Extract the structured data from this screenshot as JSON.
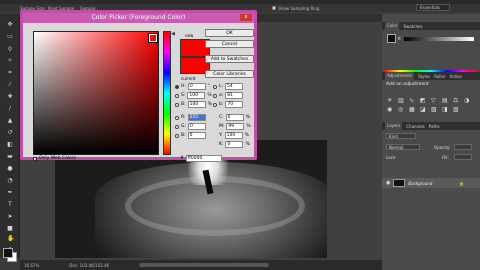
{
  "options_bar": {
    "sample_size_label": "Sample Size:",
    "sample_size_value": "Point Sample",
    "sample_label": "Sample:",
    "show_ring_label": "Show Sampling Ring"
  },
  "workspace_button": "Essentials",
  "dialog": {
    "title": "Color Picker (Foreground Color)",
    "close_label": "x",
    "new_label": "new",
    "current_label": "current",
    "buttons": {
      "ok": "OK",
      "cancel": "Cancel",
      "add_swatches": "Add to Swatches",
      "color_libraries": "Color Libraries"
    },
    "hsb": [
      {
        "label": "H:",
        "value": "0",
        "unit": "°"
      },
      {
        "label": "S:",
        "value": "100",
        "unit": "%"
      },
      {
        "label": "B:",
        "value": "100",
        "unit": "%"
      }
    ],
    "rgb": [
      {
        "label": "R:",
        "value": "255"
      },
      {
        "label": "G:",
        "value": "0"
      },
      {
        "label": "B:",
        "value": "0"
      }
    ],
    "lab": [
      {
        "label": "L:",
        "value": "54"
      },
      {
        "label": "a:",
        "value": "81"
      },
      {
        "label": "b:",
        "value": "70"
      }
    ],
    "cmyk": [
      {
        "label": "C:",
        "value": "0",
        "unit": "%"
      },
      {
        "label": "M:",
        "value": "99",
        "unit": "%"
      },
      {
        "label": "Y:",
        "value": "100",
        "unit": "%"
      },
      {
        "label": "K:",
        "value": "0",
        "unit": "%"
      }
    ],
    "only_web_colors": "Only Web Colors",
    "hex_label": "#",
    "hex_value": "ff0000",
    "selected_color": "#ff0000"
  },
  "right_panel": {
    "color_tabs": [
      "Color",
      "Swatches"
    ],
    "color_k_label": "K",
    "adjust_tabs": [
      "Adjustments",
      "Styles",
      "Roller",
      "Actios"
    ],
    "adjust_title": "Add an adjustment",
    "layer_tabs": [
      "Layers",
      "Channels",
      "Paths"
    ],
    "kind_label": "Kind",
    "blend_mode": "Normal",
    "opacity_label": "Opacity:",
    "lock_label": "Lock:",
    "fill_label": "Fill:",
    "layer_name": "Background"
  },
  "status": {
    "zoom": "16.67%",
    "doc": "Doc: 103.4K/103.4K"
  }
}
